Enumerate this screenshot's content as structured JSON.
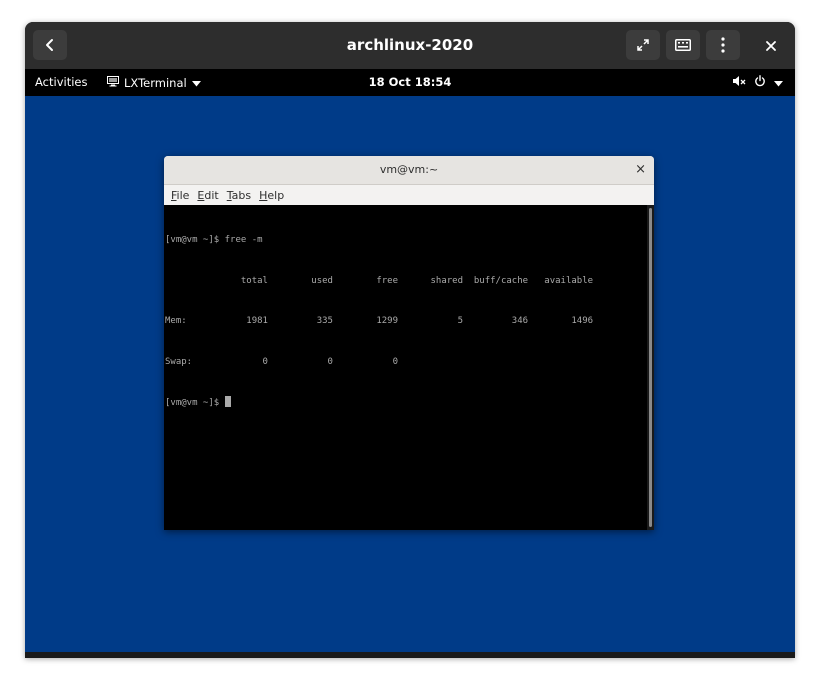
{
  "viewer": {
    "title": "archlinux-2020",
    "back_icon": "chevron-left-icon",
    "fullscreen_icon": "expand-arrows-icon",
    "keyboard_icon": "keyboard-icon",
    "menu_icon": "vertical-dots-icon",
    "close_icon": "close-icon"
  },
  "topbar": {
    "activities": "Activities",
    "app_name": "LXTerminal",
    "app_icon": "terminal-icon",
    "clock": "18 Oct  18:54",
    "status_icons": [
      "volume-muted-icon",
      "power-icon",
      "chevron-down-icon"
    ]
  },
  "terminal_window": {
    "title": "vm@vm:~",
    "close_glyph": "×",
    "menu": [
      {
        "mnemonic": "F",
        "rest": "ile"
      },
      {
        "mnemonic": "E",
        "rest": "dit"
      },
      {
        "mnemonic": "T",
        "rest": "abs"
      },
      {
        "mnemonic": "H",
        "rest": "elp"
      }
    ],
    "lines": [
      "[vm@vm ~]$ free -m",
      "              total        used        free      shared  buff/cache   available",
      "Mem:           1981         335        1299           5         346        1496",
      "Swap:             0           0           0",
      "[vm@vm ~]$ "
    ]
  },
  "colors": {
    "desktop_bg": "#003b88",
    "terminal_bg": "#000000",
    "terminal_fg": "#aaaaaa",
    "gnome_topbar": "#000000",
    "viewer_header": "#2d2d2d"
  }
}
